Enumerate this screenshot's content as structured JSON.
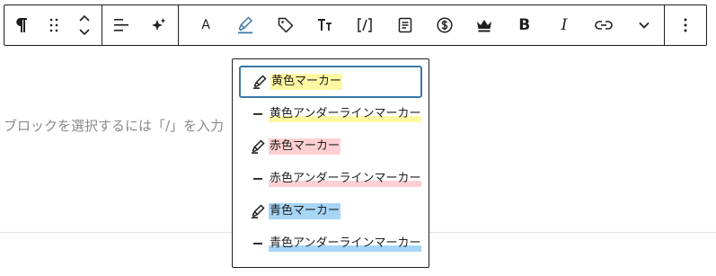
{
  "toolbar": {
    "group_block": [
      {
        "name": "paragraph-icon",
        "label": "Paragraph"
      },
      {
        "name": "drag-handle-icon",
        "label": "Drag"
      },
      {
        "name": "move-up-down-icon",
        "label": "Move up / down"
      }
    ],
    "group_align": [
      {
        "name": "align-left-icon",
        "label": "Align text"
      },
      {
        "name": "sparkle-icon",
        "label": "AI"
      }
    ],
    "group_format": {
      "font_label": "A",
      "bold_label": "B",
      "italic_label": "I",
      "items": [
        "font-icon",
        "highlighter-icon",
        "tag-icon",
        "text-size-icon",
        "code-bracket-icon",
        "document-icon",
        "dollar-circle-icon",
        "crown-icon",
        "bold-icon",
        "italic-icon",
        "link-icon",
        "chevron-down-icon"
      ]
    },
    "more_icon": "more-vertical-icon"
  },
  "editor": {
    "placeholder": "ブロックを選択するには「/」を入力"
  },
  "highlight_menu": {
    "items": [
      {
        "label": "黄色マーカー",
        "icon": "brush-icon",
        "style": "marker",
        "color": "#fff8a3",
        "focused": true
      },
      {
        "label": "黄色アンダーラインマーカー",
        "icon": "dash-icon",
        "style": "underline",
        "color": "#fff8a3",
        "focused": false
      },
      {
        "label": "赤色マーカー",
        "icon": "brush-icon",
        "style": "marker",
        "color": "#ffd0d3",
        "focused": false
      },
      {
        "label": "赤色アンダーラインマーカー",
        "icon": "dash-icon",
        "style": "underline",
        "color": "#ffd0d3",
        "focused": false
      },
      {
        "label": "青色マーカー",
        "icon": "brush-icon",
        "style": "marker",
        "color": "#a7d5f6",
        "focused": false
      },
      {
        "label": "青色アンダーラインマーカー",
        "icon": "dash-icon",
        "style": "underline",
        "color": "#a7d5f6",
        "focused": false
      }
    ]
  },
  "colors": {
    "accent": "#3a78a8",
    "highlighter_active": "#3a78a8"
  }
}
